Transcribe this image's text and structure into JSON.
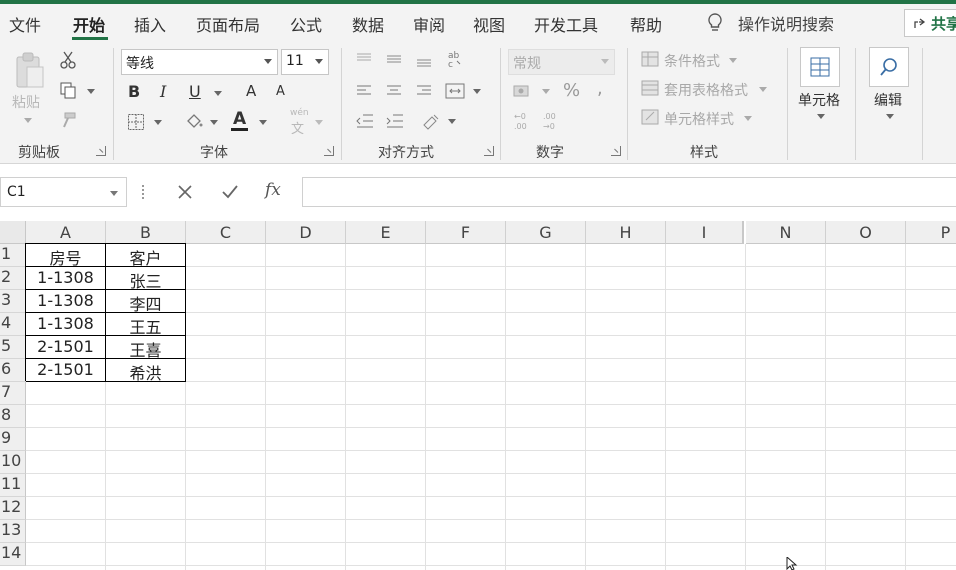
{
  "menu": {
    "tabs": [
      "文件",
      "开始",
      "插入",
      "页面布局",
      "公式",
      "数据",
      "审阅",
      "视图",
      "开发工具",
      "帮助"
    ],
    "active_tab": "开始",
    "tell_me": "操作说明搜索",
    "share": "共享"
  },
  "ribbon": {
    "clipboard": {
      "label": "剪贴板",
      "paste": "粘贴"
    },
    "font": {
      "label": "字体",
      "font_name": "等线",
      "font_size": "11",
      "bold": "B",
      "italic": "I",
      "underline": "U",
      "grow": "A",
      "shrink": "A",
      "font_color": "A",
      "phonetic_top": "wén",
      "phonetic_bottom": "文"
    },
    "alignment": {
      "label": "对齐方式"
    },
    "number": {
      "label": "数字",
      "format": "常规",
      "percent": "%",
      "comma": ","
    },
    "styles": {
      "label": "样式",
      "conditional": "条件格式",
      "table": "套用表格格式",
      "cell_styles": "单元格样式"
    },
    "cells": {
      "label": "单元格"
    },
    "editing": {
      "label": "编辑"
    }
  },
  "formula_bar": {
    "name_box": "C1",
    "fx": "fx",
    "content": ""
  },
  "sheet": {
    "columns": [
      "A",
      "B",
      "C",
      "D",
      "E",
      "F",
      "G",
      "H",
      "I",
      "N",
      "O",
      "P"
    ],
    "rows": [
      "1",
      "2",
      "3",
      "4",
      "5",
      "6",
      "7",
      "8",
      "9",
      "10",
      "11",
      "12",
      "13",
      "14"
    ],
    "data": [
      [
        "房号",
        "客户"
      ],
      [
        "1-1308",
        "张三"
      ],
      [
        "1-1308",
        "李四"
      ],
      [
        "1-1308",
        "王五"
      ],
      [
        "2-1501",
        "王喜"
      ],
      [
        "2-1501",
        "希洪"
      ]
    ]
  },
  "colors": {
    "accent": "#217346",
    "ribbon_bg": "#f3f3f3",
    "header_bg": "#efefef"
  }
}
